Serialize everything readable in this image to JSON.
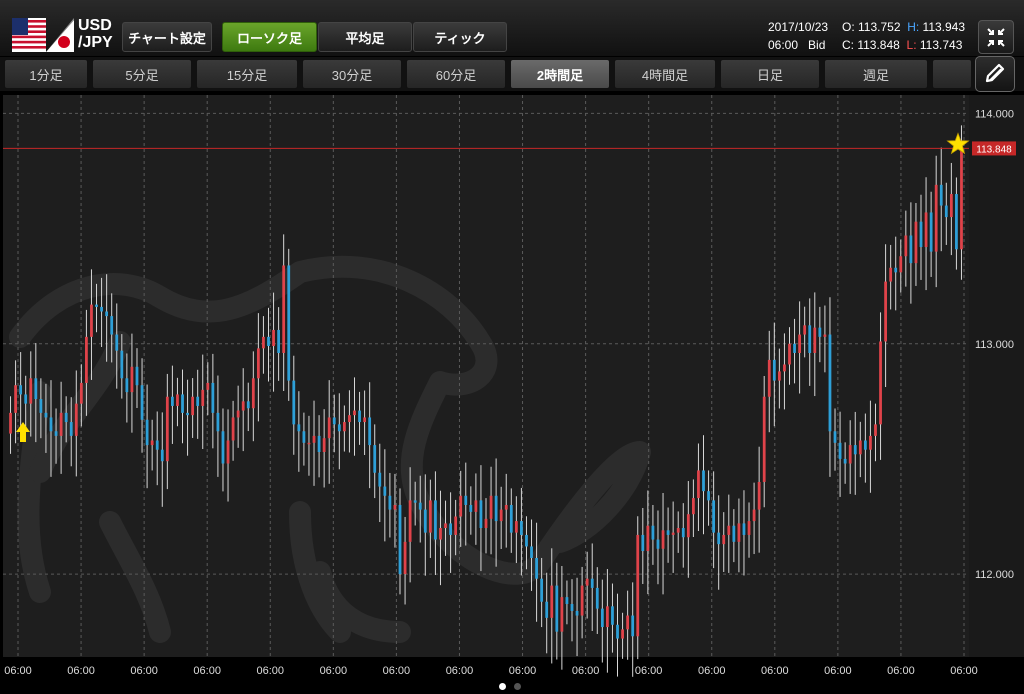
{
  "symbol": {
    "base": "USD",
    "quote": "/JPY"
  },
  "toolbar": {
    "chart_settings_label": "チャート設定",
    "chart_type_tabs": [
      {
        "label": "ローソク足",
        "active": true
      },
      {
        "label": "平均足",
        "active": false
      },
      {
        "label": "ティック",
        "active": false
      }
    ]
  },
  "quote": {
    "date": "2017/10/23",
    "time": "06:00",
    "side": "Bid",
    "open_label": "O:",
    "open": "113.752",
    "high_label": "H:",
    "high": "113.943",
    "close_label": "C:",
    "close": "113.848",
    "low_label": "L:",
    "low": "113.743"
  },
  "timeframe_tabs": [
    {
      "label": "1分足",
      "active": false
    },
    {
      "label": "5分足",
      "active": false
    },
    {
      "label": "15分足",
      "active": false
    },
    {
      "label": "30分足",
      "active": false
    },
    {
      "label": "60分足",
      "active": false
    },
    {
      "label": "2時間足",
      "active": true
    },
    {
      "label": "4時間足",
      "active": false
    },
    {
      "label": "日足",
      "active": false
    },
    {
      "label": "週足",
      "active": false
    }
  ],
  "colors": {
    "up": "#e0434a",
    "down": "#2ea0d8",
    "price_line": "#c62828",
    "grid": "#5a5a5a",
    "background": "#1e1e1e",
    "active_tab": "#4d8c1a",
    "marker": "#ffe000"
  },
  "icons": {
    "flag": "usd-jpy-flag-icon",
    "expand": "collapse-arrows-icon",
    "draw": "pencil-icon",
    "marker_up": "arrow-up-icon",
    "marker_star": "star-icon"
  },
  "chart_data": {
    "type": "candlestick",
    "ylim": [
      111.64,
      114.08
    ],
    "y_ticks": [
      "114.000",
      "113.000",
      "112.000"
    ],
    "x_ticks": [
      "06:00",
      "06:00",
      "06:00",
      "06:00",
      "06:00",
      "06:00",
      "06:00",
      "06:00",
      "06:00",
      "06:00",
      "06:00",
      "06:00",
      "06:00",
      "06:00",
      "06:00",
      "06:00"
    ],
    "current_price_label": "113.848",
    "current_price": 113.848,
    "grid": true,
    "close": [
      112.7,
      112.82,
      112.78,
      112.74,
      112.85,
      112.76,
      112.7,
      112.68,
      112.62,
      112.6,
      112.7,
      112.66,
      112.6,
      112.74,
      112.83,
      113.03,
      113.17,
      113.16,
      113.14,
      113.12,
      113.04,
      112.97,
      112.85,
      112.79,
      112.9,
      112.82,
      112.67,
      112.56,
      112.58,
      112.54,
      112.49,
      112.77,
      112.73,
      112.78,
      112.7,
      112.69,
      112.77,
      112.73,
      112.8,
      112.83,
      112.7,
      112.62,
      112.48,
      112.58,
      112.68,
      112.71,
      112.75,
      112.72,
      112.85,
      112.98,
      113.03,
      112.99,
      113.06,
      112.96,
      113.34,
      112.84,
      112.65,
      112.62,
      112.57,
      112.57,
      112.6,
      112.53,
      112.59,
      112.68,
      112.65,
      112.62,
      112.66,
      112.69,
      112.71,
      112.66,
      112.68,
      112.56,
      112.44,
      112.38,
      112.34,
      112.28,
      112.3,
      112.0,
      112.14,
      112.32,
      112.31,
      112.28,
      112.18,
      112.32,
      112.15,
      112.2,
      112.22,
      112.17,
      112.25,
      112.34,
      112.3,
      112.27,
      112.32,
      112.2,
      112.24,
      112.34,
      112.23,
      112.28,
      112.3,
      112.18,
      112.23,
      112.17,
      112.12,
      112.07,
      111.98,
      111.88,
      111.81,
      111.95,
      111.75,
      111.9,
      111.87,
      111.84,
      111.82,
      111.95,
      111.98,
      111.94,
      111.85,
      111.77,
      111.86,
      111.78,
      111.72,
      111.76,
      111.82,
      111.73,
      112.17,
      112.1,
      112.21,
      112.15,
      112.11,
      112.19,
      112.17,
      112.18,
      112.2,
      112.16,
      112.26,
      112.33,
      112.45,
      112.36,
      112.32,
      112.18,
      112.13,
      112.17,
      112.21,
      112.14,
      112.22,
      112.17,
      112.23,
      112.28,
      112.4,
      112.77,
      112.93,
      112.84,
      112.88,
      112.91,
      113.0,
      112.96,
      113.04,
      113.08,
      112.96,
      113.07,
      113.03,
      113.04,
      112.62,
      112.57,
      112.5,
      112.48,
      112.56,
      112.52,
      112.58,
      112.54,
      112.6,
      112.65,
      113.01,
      113.27,
      113.33,
      113.31,
      113.38,
      113.47,
      113.35,
      113.53,
      113.42,
      113.57,
      113.4,
      113.69,
      113.6,
      113.55,
      113.65,
      113.41,
      113.84
    ],
    "open": [
      112.61,
      112.7,
      112.82,
      112.78,
      112.74,
      112.85,
      112.76,
      112.7,
      112.68,
      112.62,
      112.6,
      112.7,
      112.66,
      112.6,
      112.74,
      112.83,
      113.03,
      113.17,
      113.16,
      113.14,
      113.12,
      113.04,
      112.97,
      112.85,
      112.79,
      112.9,
      112.82,
      112.67,
      112.56,
      112.58,
      112.54,
      112.49,
      112.77,
      112.73,
      112.78,
      112.7,
      112.69,
      112.77,
      112.73,
      112.8,
      112.83,
      112.7,
      112.62,
      112.48,
      112.58,
      112.68,
      112.71,
      112.75,
      112.72,
      112.85,
      112.98,
      113.03,
      112.99,
      113.06,
      112.96,
      113.34,
      112.84,
      112.65,
      112.62,
      112.57,
      112.57,
      112.6,
      112.53,
      112.59,
      112.68,
      112.65,
      112.62,
      112.66,
      112.69,
      112.71,
      112.66,
      112.68,
      112.56,
      112.44,
      112.38,
      112.34,
      112.28,
      112.3,
      112.0,
      112.14,
      112.32,
      112.31,
      112.28,
      112.18,
      112.32,
      112.15,
      112.2,
      112.22,
      112.17,
      112.25,
      112.34,
      112.3,
      112.27,
      112.32,
      112.2,
      112.24,
      112.34,
      112.23,
      112.28,
      112.3,
      112.18,
      112.23,
      112.17,
      112.12,
      112.07,
      111.98,
      111.88,
      111.81,
      111.95,
      111.75,
      111.9,
      111.87,
      111.84,
      111.82,
      111.95,
      111.98,
      111.94,
      111.85,
      111.77,
      111.86,
      111.78,
      111.72,
      111.76,
      111.82,
      111.73,
      112.17,
      112.1,
      112.21,
      112.15,
      112.11,
      112.19,
      112.17,
      112.18,
      112.2,
      112.16,
      112.26,
      112.33,
      112.45,
      112.36,
      112.32,
      112.18,
      112.13,
      112.17,
      112.21,
      112.14,
      112.22,
      112.17,
      112.23,
      112.28,
      112.4,
      112.77,
      112.93,
      112.84,
      112.88,
      112.91,
      113.0,
      112.96,
      113.04,
      113.08,
      112.96,
      113.07,
      113.03,
      113.04,
      112.62,
      112.57,
      112.5,
      112.48,
      112.56,
      112.52,
      112.58,
      112.54,
      112.6,
      112.65,
      113.01,
      113.27,
      113.33,
      113.31,
      113.38,
      113.47,
      113.35,
      113.53,
      113.42,
      113.57,
      113.4,
      113.69,
      113.6,
      113.55,
      113.65,
      113.41
    ]
  }
}
